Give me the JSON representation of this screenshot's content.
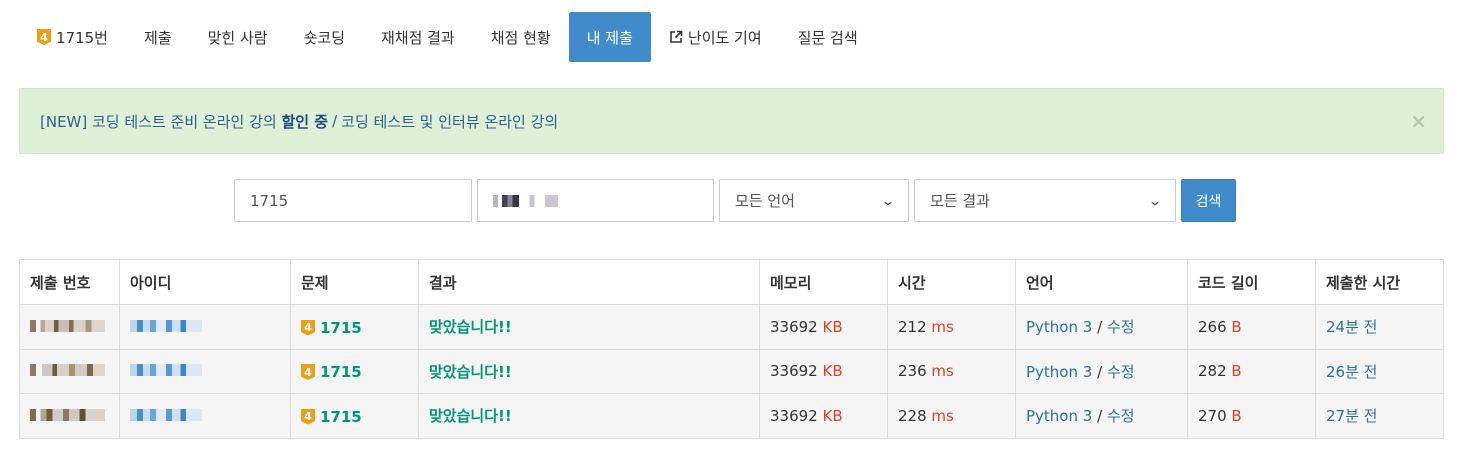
{
  "nav": {
    "problem_tier": "4",
    "problem_label": "1715번",
    "tabs": [
      "제출",
      "맞힌 사람",
      "숏코딩",
      "재채점 결과",
      "채점 현황",
      "내 제출",
      "난이도 기여",
      "질문 검색"
    ]
  },
  "alert": {
    "prefix": "[NEW] 코딩 테스트 준비 온라인 강의 ",
    "bold": "할인 중",
    "separator": "/",
    "suffix": "코딩 테스트 및 인터뷰 온라인 강의",
    "close": "×"
  },
  "search": {
    "problem_value": "1715",
    "language_selected": "모든 언어",
    "result_selected": "모든 결과",
    "button": "검색"
  },
  "table": {
    "headers": [
      "제출 번호",
      "아이디",
      "문제",
      "결과",
      "메모리",
      "시간",
      "언어",
      "코드 길이",
      "제출한 시간"
    ],
    "rows": [
      {
        "problem": "1715",
        "tier": "4",
        "result": "맞았습니다!!",
        "memory": "33692",
        "memory_unit": "KB",
        "time": "212",
        "time_unit": "ms",
        "language": "Python 3",
        "sep": "/",
        "edit": "수정",
        "code_len": "266",
        "code_unit": "B",
        "submitted": "24분 전"
      },
      {
        "problem": "1715",
        "tier": "4",
        "result": "맞았습니다!!",
        "memory": "33692",
        "memory_unit": "KB",
        "time": "236",
        "time_unit": "ms",
        "language": "Python 3",
        "sep": "/",
        "edit": "수정",
        "code_len": "282",
        "code_unit": "B",
        "submitted": "26분 전"
      },
      {
        "problem": "1715",
        "tier": "4",
        "result": "맞았습니다!!",
        "memory": "33692",
        "memory_unit": "KB",
        "time": "228",
        "time_unit": "ms",
        "language": "Python 3",
        "sep": "/",
        "edit": "수정",
        "code_len": "270",
        "code_unit": "B",
        "submitted": "27분 전"
      }
    ]
  },
  "colors": {
    "primary": "#428bca",
    "success_text": "#009874",
    "unit_red": "#dd4124",
    "alert_bg": "#dff0d8",
    "tier_gold": "#e9a11a"
  }
}
